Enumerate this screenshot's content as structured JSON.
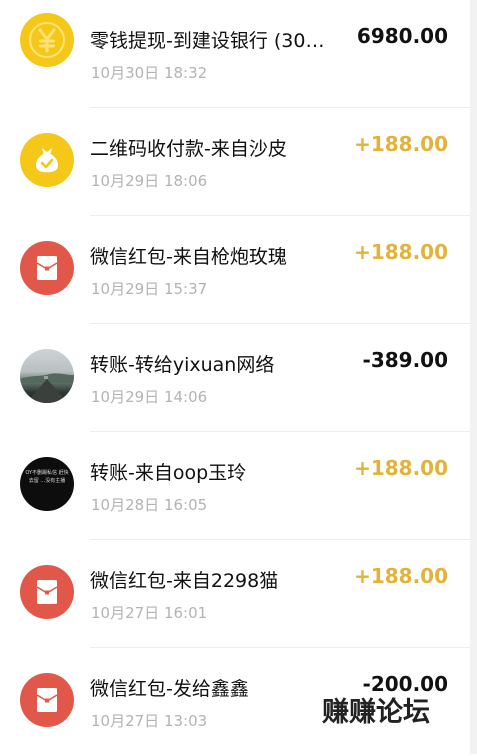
{
  "transactions": [
    {
      "title": "零钱提现-到建设银行 (30…",
      "time": "10月30日 18:32",
      "amount": "6980.00",
      "icon": "yuan-coin-icon"
    },
    {
      "title": "二维码收付款-来自沙皮",
      "time": "10月29日 18:06",
      "amount": "+188.00",
      "icon": "money-bag-icon"
    },
    {
      "title": "微信红包-来自枪炮玫瑰",
      "time": "10月29日 15:37",
      "amount": "+188.00",
      "icon": "red-packet-icon"
    },
    {
      "title": "转账-转给yixuan网络",
      "time": "10月29日 14:06",
      "amount": "-389.00",
      "icon": "avatar-photo"
    },
    {
      "title": "转账-来自oop玉玲",
      "time": "10月28日 16:05",
      "amount": "+188.00",
      "icon": "avatar-photo"
    },
    {
      "title": "微信红包-来自2298猫",
      "time": "10月27日 16:01",
      "amount": "+188.00",
      "icon": "red-packet-icon"
    },
    {
      "title": "微信红包-发给鑫鑫",
      "time": "10月27日 13:03",
      "amount": "-200.00",
      "icon": "red-packet-icon"
    }
  ],
  "avatar_text": "OY不删踢私信 赶快去留 …没有主播",
  "watermark": "赚赚论坛",
  "colors": {
    "income": "#e2b33a",
    "expense": "#111111",
    "coin": "#f5c718",
    "red_packet": "#e1584b",
    "time": "#b3b3b3"
  }
}
